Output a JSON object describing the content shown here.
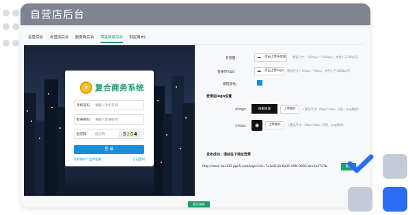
{
  "window": {
    "title": "自营店后台"
  },
  "tabs": [
    {
      "label": "运营后台",
      "active": false
    },
    {
      "label": "自营店后台",
      "active": false
    },
    {
      "label": "服务商后台",
      "active": false
    },
    {
      "label": "零售商家后台",
      "active": true
    },
    {
      "label": "供应商H5",
      "active": false
    }
  ],
  "preview": {
    "brand": "复合商务系统",
    "phone_label": "手机号码",
    "phone_placeholder": "请输入手机号码",
    "password_label": "登录密码",
    "password_placeholder": "请输入登录密码",
    "captcha_label": "验证码",
    "captcha_placeholder": "验证码",
    "captcha_code": "5254",
    "login_button": "登 录",
    "register_link": "没有账号? 立即注册",
    "forgot_link": "忘记密码"
  },
  "settings": {
    "background_label": "背景图:",
    "background_button": "点击上传背景图",
    "background_hint": "建议尺寸：1920px * 1080px，文件小于3M以内",
    "logo_label": "登录页logo:",
    "logo_button": "点击上传logo",
    "logo_hint": "建议尺寸：300px * 60px，文件小于10KB以内",
    "color_label": "按钮颜色:",
    "button_color": "#1a8fd6",
    "after_login_logo_title": "登录后logo设置",
    "big_logo_label": "大logo:",
    "big_logo_preview": "搜服商城",
    "big_logo_button": "上传图片",
    "big_logo_hint": "(建议尺寸：80px*30px, 白色，png格式)",
    "small_logo_label": "小logo:",
    "small_logo_button": "上传图片",
    "small_logo_hint": "(建议尺寸：30px*30px, 白色，png格式)",
    "publish_msg": "发布成功，请前往下地址登录",
    "url": "http://retail.dev122.pgv5.com/login?cid=7c3e4139-6e05-45f4-9003-4ce2a4737b",
    "copy_button": "复制"
  },
  "footer": {
    "submit_button": "提交发布"
  },
  "colors": {
    "brand_green": "#1e9d6d",
    "accent_blue": "#2a6df4",
    "deco_gray": "#c5cbd6"
  }
}
